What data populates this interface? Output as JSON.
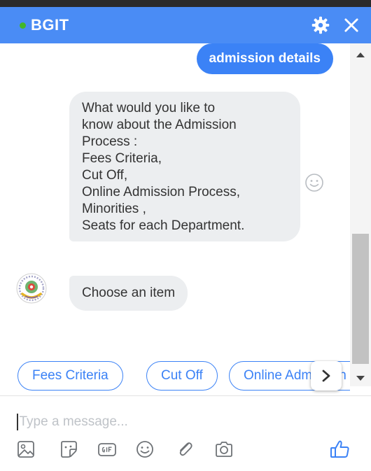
{
  "header": {
    "title": "BGIT",
    "status": "online",
    "settings_icon": "gear-icon",
    "close_icon": "close-icon"
  },
  "colors": {
    "header_bg": "#4a8cf5",
    "outgoing_bubble": "#3b82f6",
    "incoming_bubble": "#eceef0",
    "online_dot": "#42b72a",
    "accent": "#3b82f6"
  },
  "messages": {
    "outgoing": {
      "text": "admission details"
    },
    "incoming": {
      "lines": [
        "What would you like to",
        "know about the Admission",
        "Process :",
        "Fees Criteria,",
        "Cut Off,",
        "Online Admission Process,",
        "Minorities ,",
        "Seats for each Department."
      ]
    },
    "prompt": {
      "text": "Choose an item"
    }
  },
  "quick_replies": {
    "items": [
      {
        "label": "Fees Criteria"
      },
      {
        "label": "Cut Off"
      },
      {
        "label": "Online Admission Process"
      }
    ],
    "next_icon": "chevron-right-icon"
  },
  "composer": {
    "placeholder": "Type a message..."
  },
  "toolbar": {
    "icons": [
      "image-icon",
      "sticker-icon",
      "gif-icon",
      "emoji-icon",
      "paperclip-icon",
      "camera-icon"
    ],
    "like_icon": "thumbs-up-icon"
  }
}
